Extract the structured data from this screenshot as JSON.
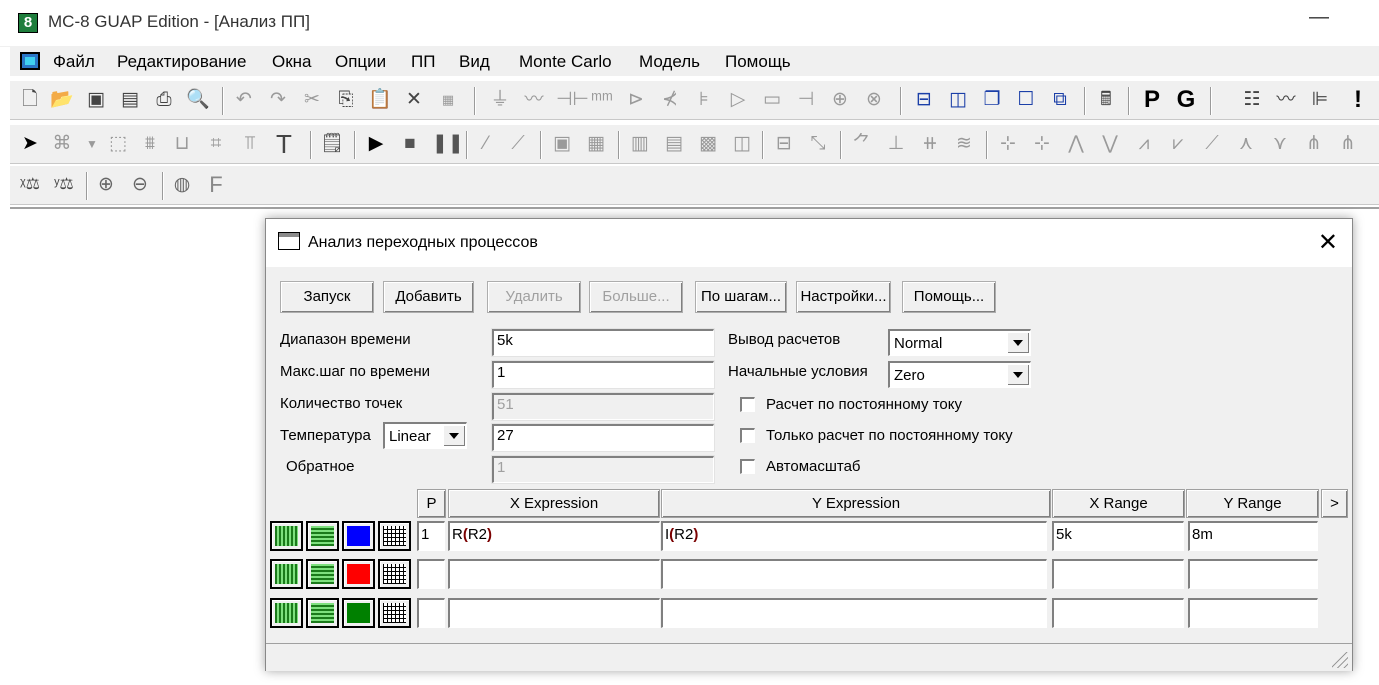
{
  "window": {
    "app_icon": "8",
    "title": "MC-8 GUAP Edition - [Анализ ПП]",
    "minimize": "—"
  },
  "menu": {
    "items": [
      "Файл",
      "Редактирование",
      "Окна",
      "Опции",
      "ПП",
      "Вид",
      "Monte Carlo",
      "Модель",
      "Помощь"
    ]
  },
  "toolbar": {
    "p_label": "P",
    "g_label": "G",
    "t_label": "T",
    "f_label": "F",
    "exclam": "!"
  },
  "dialog": {
    "title": "Анализ переходных процессов",
    "close": "✕",
    "buttons": {
      "run": "Запуск",
      "add": "Добавить",
      "delete": "Удалить",
      "more": "Больше...",
      "step": "По шагам...",
      "settings": "Настройки...",
      "help": "Помощь..."
    },
    "time_range": {
      "label": "Диапазон времени",
      "value": "5k"
    },
    "max_step": {
      "label": "Макс.шаг по времени",
      "value": "1"
    },
    "num_points": {
      "label": "Количество точек",
      "value": "51"
    },
    "temperature": {
      "label": "Температура",
      "mode": "Linear",
      "value": "27"
    },
    "reverse": {
      "label": "Обратное",
      "value": "1"
    },
    "output": {
      "label": "Вывод расчетов",
      "value": "Normal"
    },
    "initial": {
      "label": "Начальные условия",
      "value": "Zero"
    },
    "checks": {
      "dc": {
        "label": "Расчет по постоянному току",
        "checked": false
      },
      "dc_only": {
        "label": "Только расчет по постоянному току",
        "checked": false
      },
      "autoscale": {
        "label": "Автомасштаб",
        "checked": false
      }
    },
    "grid": {
      "headers": {
        "p": "P",
        "x_expr": "X Expression",
        "y_expr": "Y Expression",
        "x_range": "X Range",
        "y_range": "Y Range",
        "more": ">"
      },
      "rows": [
        {
          "color": "#0000ff",
          "p": "1",
          "x_func": "R",
          "x_arg": "R2",
          "y_func": "I",
          "y_arg": "R2",
          "x_range": "5k",
          "y_range": "8m"
        },
        {
          "color": "#ff0000",
          "p": "",
          "x_func": "",
          "x_arg": "",
          "y_func": "",
          "y_arg": "",
          "x_range": "",
          "y_range": ""
        },
        {
          "color": "#008000",
          "p": "",
          "x_func": "",
          "x_arg": "",
          "y_func": "",
          "y_arg": "",
          "x_range": "",
          "y_range": ""
        }
      ]
    }
  }
}
